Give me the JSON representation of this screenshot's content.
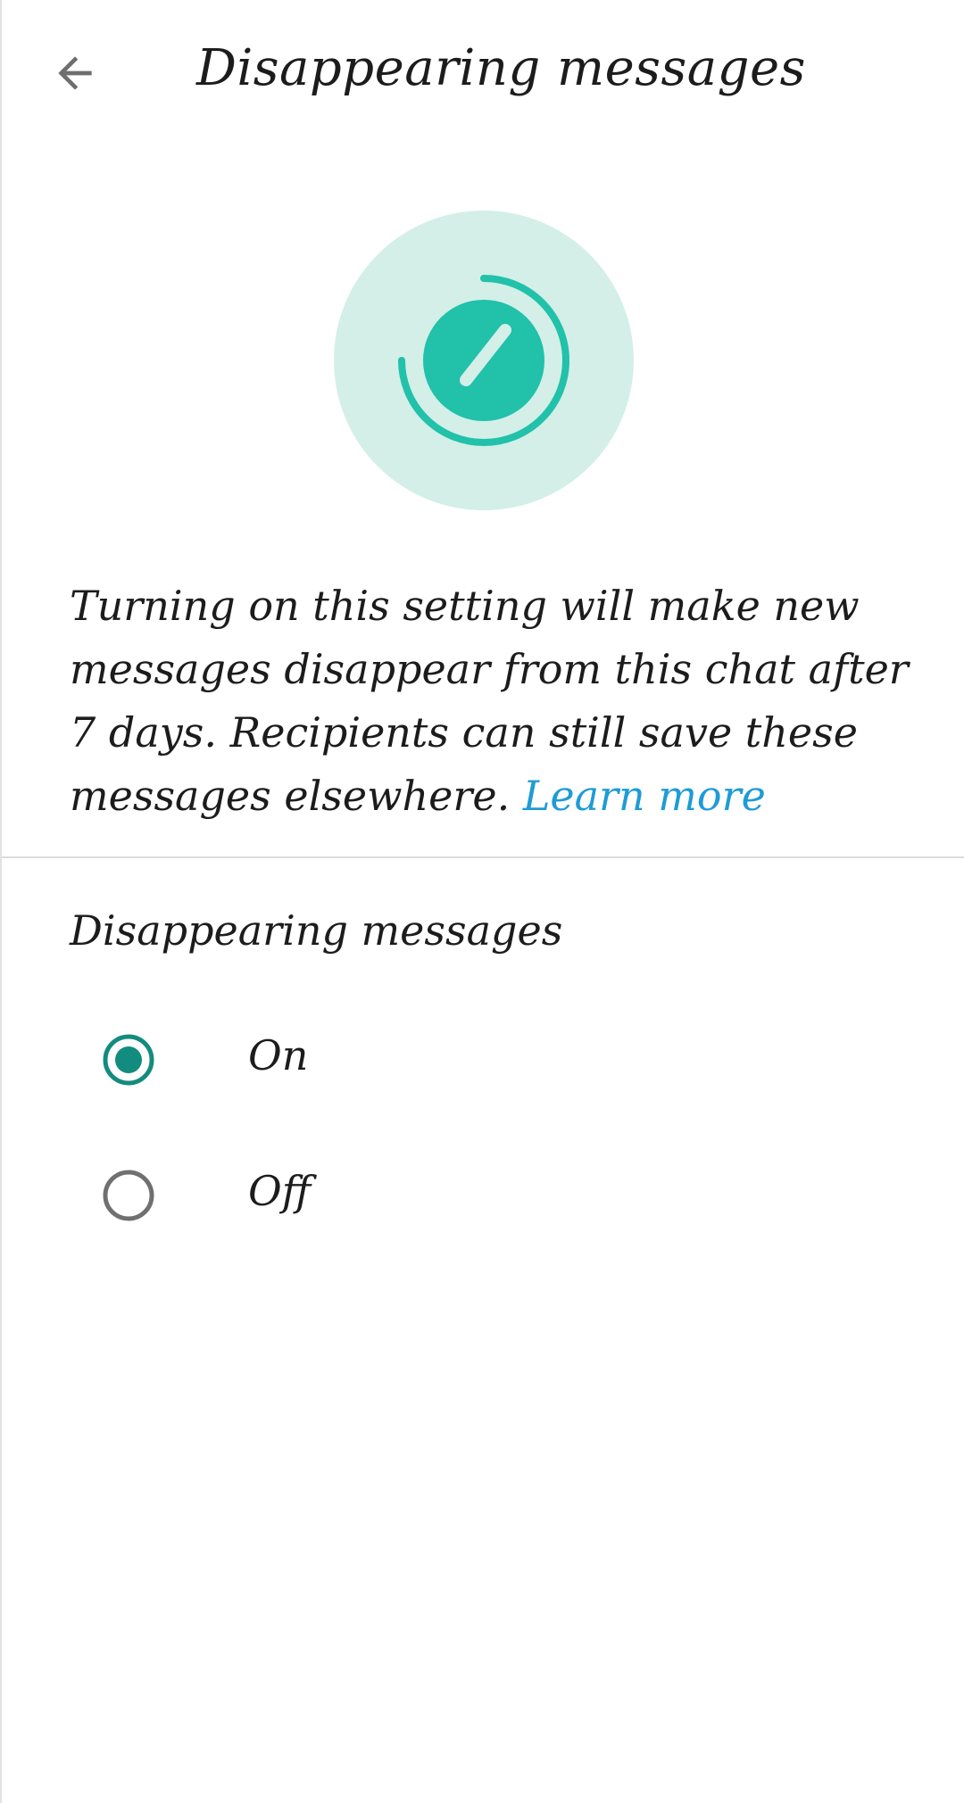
{
  "header": {
    "back_icon": "arrow-left-icon",
    "title": "Disappearing messages"
  },
  "hero": {
    "icon": "timer-icon",
    "circle_color": "#d3efe8",
    "accent_color": "#21c1aa"
  },
  "description": {
    "text": "Turning on this setting will make new messages disappear from this chat after 7 days. Recipients can still save these messages elsewhere. ",
    "link_label": "Learn more",
    "link_color": "#1f9bd6"
  },
  "section": {
    "label": "Disappearing messages"
  },
  "options": [
    {
      "label": "On",
      "selected": true
    },
    {
      "label": "Off",
      "selected": false
    }
  ],
  "colors": {
    "radio_selected": "#128c7e",
    "radio_unselected": "#707070"
  }
}
